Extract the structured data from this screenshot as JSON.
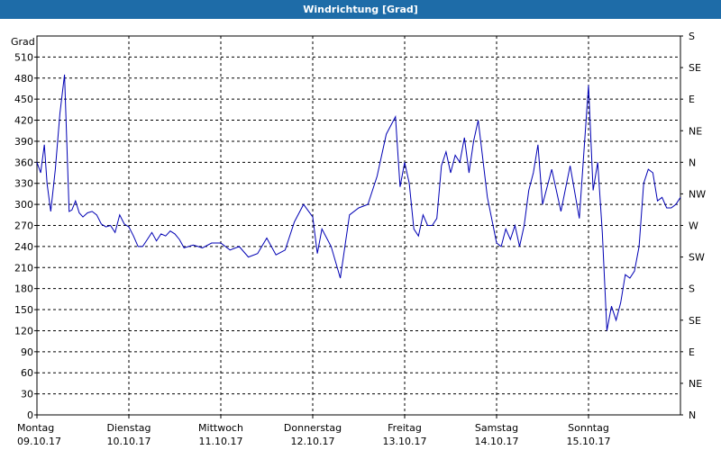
{
  "window": {
    "title": "Windrichtung [Grad]"
  },
  "chart_data": {
    "type": "line",
    "title": "Windrichtung [Grad]",
    "ylabel": "Grad",
    "ylim": [
      0,
      540
    ],
    "yticks": [
      0,
      30,
      60,
      90,
      120,
      150,
      180,
      210,
      240,
      270,
      300,
      330,
      360,
      390,
      420,
      450,
      480,
      510
    ],
    "right_axis_labels": [
      "N",
      "NE",
      "E",
      "SE",
      "S",
      "SW",
      "W",
      "NW",
      "N",
      "NE",
      "E",
      "SE",
      "S"
    ],
    "xlim": [
      0,
      7
    ],
    "x_days": [
      {
        "day": "Montag",
        "date": "09.10.17"
      },
      {
        "day": "Dienstag",
        "date": "10.10.17"
      },
      {
        "day": "Mittwoch",
        "date": "11.10.17"
      },
      {
        "day": "Donnerstag",
        "date": "12.10.17"
      },
      {
        "day": "Freitag",
        "date": "13.10.17"
      },
      {
        "day": "Samstag",
        "date": "14.10.17"
      },
      {
        "day": "Sonntag",
        "date": "15.10.17"
      }
    ],
    "grid": true,
    "line_color": "#0000b4",
    "series": [
      {
        "x": [
          0.0,
          0.04,
          0.08,
          0.11,
          0.15,
          0.2,
          0.25,
          0.3,
          0.35,
          0.38,
          0.42,
          0.46,
          0.5,
          0.55,
          0.6,
          0.65,
          0.7,
          0.75,
          0.8,
          0.85,
          0.9,
          0.95,
          1.0,
          1.05,
          1.1,
          1.15,
          1.2,
          1.25,
          1.3,
          1.35,
          1.4,
          1.45,
          1.5,
          1.55,
          1.6,
          1.7,
          1.8,
          1.9,
          2.0,
          2.1,
          2.2,
          2.3,
          2.4,
          2.5,
          2.6,
          2.7,
          2.8,
          2.9,
          3.0,
          3.05,
          3.1,
          3.2,
          3.3,
          3.4,
          3.5,
          3.6,
          3.7,
          3.8,
          3.9,
          3.95,
          4.0,
          4.05,
          4.1,
          4.15,
          4.2,
          4.25,
          4.3,
          4.35,
          4.4,
          4.45,
          4.5,
          4.55,
          4.6,
          4.65,
          4.7,
          4.75,
          4.8,
          4.9,
          5.0,
          5.05,
          5.1,
          5.15,
          5.2,
          5.25,
          5.3,
          5.35,
          5.4,
          5.45,
          5.5,
          5.6,
          5.7,
          5.8,
          5.9,
          6.0,
          6.05,
          6.1,
          6.15,
          6.2,
          6.25,
          6.3,
          6.35,
          6.4,
          6.45,
          6.5,
          6.55,
          6.6,
          6.65,
          6.7,
          6.75,
          6.8,
          6.85,
          6.9,
          6.95,
          7.0
        ],
        "y": [
          360,
          345,
          385,
          330,
          290,
          350,
          430,
          485,
          290,
          292,
          305,
          288,
          282,
          288,
          290,
          285,
          272,
          268,
          270,
          260,
          285,
          272,
          268,
          255,
          240,
          240,
          250,
          260,
          248,
          258,
          255,
          262,
          258,
          250,
          238,
          242,
          238,
          245,
          245,
          235,
          240,
          225,
          230,
          252,
          228,
          235,
          275,
          300,
          282,
          230,
          265,
          240,
          195,
          285,
          295,
          300,
          340,
          400,
          425,
          325,
          360,
          330,
          265,
          255,
          285,
          270,
          270,
          280,
          355,
          375,
          345,
          370,
          360,
          395,
          345,
          390,
          420,
          310,
          245,
          240,
          265,
          250,
          270,
          240,
          270,
          320,
          345,
          385,
          300,
          350,
          290,
          355,
          280,
          470,
          320,
          360,
          260,
          120,
          155,
          135,
          160,
          200,
          195,
          205,
          240,
          330,
          350,
          345,
          305,
          310,
          295,
          295,
          300,
          310
        ]
      }
    ]
  }
}
